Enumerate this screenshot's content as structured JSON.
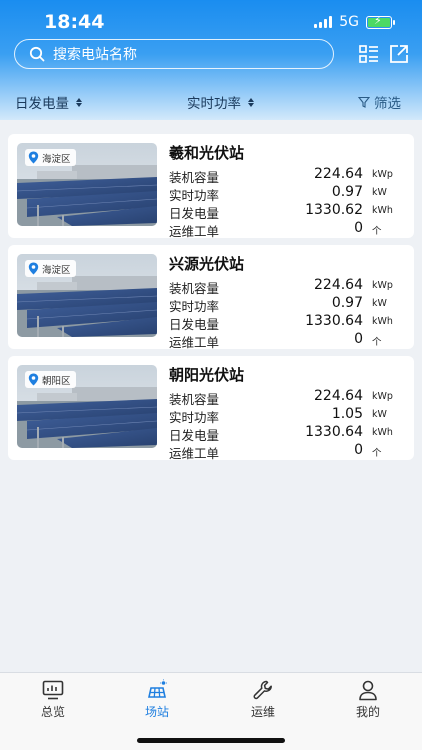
{
  "status": {
    "time": "18:44",
    "network": "5G"
  },
  "search": {
    "placeholder": "搜索电站名称"
  },
  "filters": {
    "date": "日发电量",
    "power": "实时功率",
    "screen": "筛选"
  },
  "labels": {
    "capacity": "装机容量",
    "power": "实时功率",
    "energy": "日发电量",
    "tickets": "运维工单"
  },
  "units": {
    "capacity": "kWp",
    "power": "kW",
    "energy": "kWh",
    "tickets": "个"
  },
  "stations": [
    {
      "name": "羲和光伏站",
      "district": "海淀区",
      "capacity": "224.64",
      "power": "0.97",
      "energy": "1330.62",
      "tickets": "0"
    },
    {
      "name": "兴源光伏站",
      "district": "海淀区",
      "capacity": "224.64",
      "power": "0.97",
      "energy": "1330.64",
      "tickets": "0"
    },
    {
      "name": "朝阳光伏站",
      "district": "朝阳区",
      "capacity": "224.64",
      "power": "1.05",
      "energy": "1330.64",
      "tickets": "0"
    }
  ],
  "tabs": [
    {
      "label": "总览",
      "icon": "monitor-chart-icon",
      "active": false
    },
    {
      "label": "场站",
      "icon": "solar-panel-icon",
      "active": true
    },
    {
      "label": "运维",
      "icon": "wrench-icon",
      "active": false
    },
    {
      "label": "我的",
      "icon": "user-icon",
      "active": false
    }
  ],
  "colors": {
    "accent": "#1f7fe0",
    "header": "#1a8df0"
  }
}
